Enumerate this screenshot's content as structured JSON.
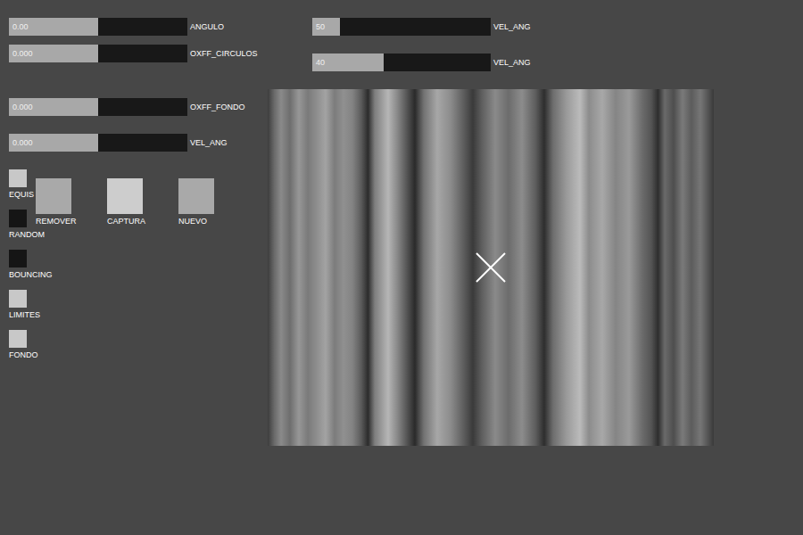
{
  "sliders": [
    {
      "label": "ANGULO",
      "value": "0.00",
      "level": 0.5
    },
    {
      "label": "OXFF_CIRCULOS",
      "value": "0.000",
      "level": 0.5
    },
    {
      "label": "OXFF_FONDO",
      "value": "0.000",
      "level": 0.5
    },
    {
      "label": "VEL_ANG",
      "value": "0.000",
      "level": 0.5
    },
    {
      "label": "VEL_ANG",
      "value": "50",
      "level": 0.155
    },
    {
      "label": "VEL_ANG",
      "value": "40",
      "level": 0.4
    }
  ],
  "toggles": [
    {
      "label": "EQUIS",
      "checked": true
    },
    {
      "label": "RANDOM",
      "checked": false
    },
    {
      "label": "BOUNCING",
      "checked": false
    },
    {
      "label": "LIMITES",
      "checked": true
    },
    {
      "label": "FONDO",
      "checked": true
    }
  ],
  "buttons": [
    {
      "label": "REMOVER",
      "hover": false
    },
    {
      "label": "CAPTURA",
      "hover": true
    },
    {
      "label": "NUEVO",
      "hover": false
    }
  ]
}
